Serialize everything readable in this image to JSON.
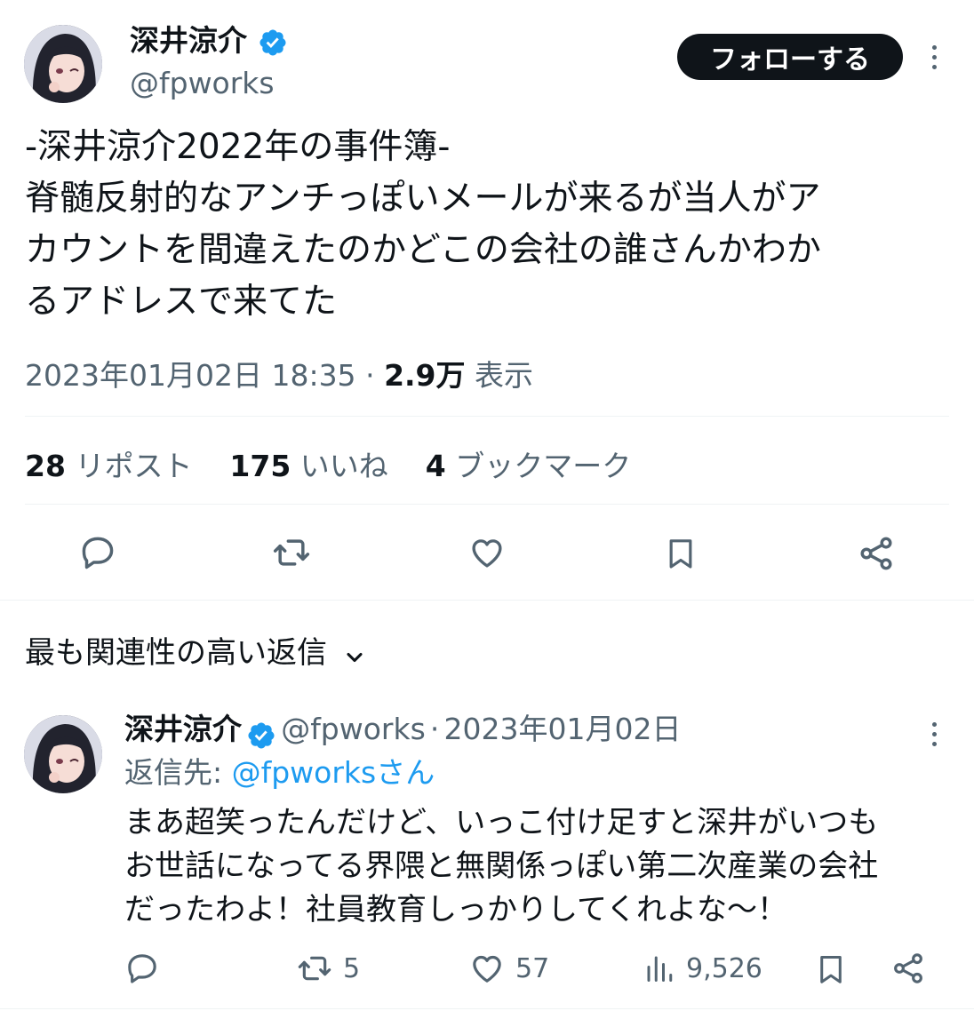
{
  "tweet": {
    "author_name": "深井涼介",
    "author_handle": "@fpworks",
    "follow_label": "フォローする",
    "text": "-深井涼介2022年の事件簿-\n脊髄反射的なアンチっぽいメールが来るが当人がア\nカウントを間違えたのかどこの会社の誰さんかわか\nるアドレスで来てた",
    "timestamp": "2023年01月02日 18:35",
    "separator": "·",
    "views_count": "2.9万",
    "views_label": "表示",
    "reposts_count": "28",
    "reposts_label": "リポスト",
    "likes_count": "175",
    "likes_label": "いいね",
    "bookmarks_count": "4",
    "bookmarks_label": "ブックマーク"
  },
  "replies_header": {
    "sort_label": "最も関連性の高い返信"
  },
  "reply": {
    "author_name": "深井涼介",
    "author_handle": "@fpworks",
    "separator": "·",
    "date": "2023年01月02日",
    "reply_to_prefix": "返信先: ",
    "reply_to_handle": "@fpworksさん",
    "text": "まあ超笑ったんだけど、いっこ付け足すと深井がいつも\nお世話になってる界隈と無関係っぽい第二次産業の会社\nだったわよ！社員教育しっかりしてくれよな〜！",
    "retweet_count": "5",
    "like_count": "57",
    "views_count": "9,526"
  },
  "colors": {
    "text_primary": "#0f1419",
    "text_secondary": "#536471",
    "verified_blue": "#1d9bf0",
    "link_blue": "#1d9bf0",
    "divider": "#eff3f4",
    "follow_bg": "#0f1419"
  },
  "icons": {
    "verified": "verified-badge-icon",
    "more": "more-dots-icon",
    "reply": "reply-icon",
    "retweet": "retweet-icon",
    "like": "heart-icon",
    "bookmark": "bookmark-icon",
    "share": "share-icon",
    "views": "views-chart-icon",
    "chevron": "chevron-down-icon"
  }
}
